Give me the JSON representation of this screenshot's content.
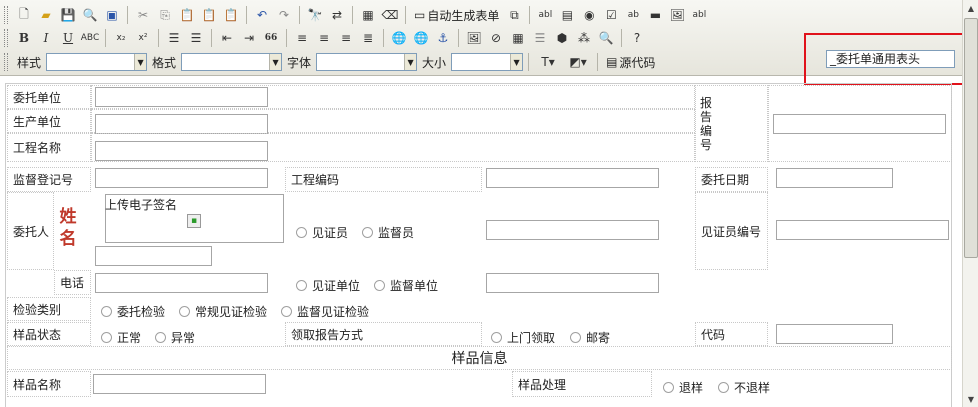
{
  "toolbar": {
    "auto_form": "自动生成表单",
    "style_label": "样式",
    "format_label": "格式",
    "font_label": "字体",
    "size_label": "大小",
    "source_label": "源代码",
    "header_field_value": "_委托单通用表头",
    "icons_row1": [
      "new-doc-icon",
      "open-folder-icon",
      "save-icon",
      "preview-icon",
      "template-icon",
      "cut-icon",
      "copy-icon",
      "paste-icon",
      "paste-text-icon",
      "paste-word-icon",
      "undo-icon",
      "redo-icon",
      "find-icon",
      "replace-icon",
      "select-all-icon",
      "eraser-icon",
      "form-icon",
      "form-attr-icon",
      "textfield-icon",
      "textarea-icon",
      "radio-icon",
      "checkbox-icon",
      "list-icon",
      "button-icon",
      "image-button-icon",
      "hidden-field-icon"
    ],
    "icons_row2": [
      "bold-icon",
      "italic-icon",
      "underline-icon",
      "strikethrough-icon",
      "subscript-icon",
      "superscript-icon",
      "ordered-list-icon",
      "unordered-list-icon",
      "outdent-icon",
      "indent-icon",
      "blockquote-icon",
      "align-left-icon",
      "align-center-icon",
      "align-right-icon",
      "justify-icon",
      "link-icon",
      "unlink-icon",
      "anchor-icon",
      "image-icon",
      "flash-icon",
      "table-icon",
      "hr-icon",
      "smiley-icon",
      "special-char-icon",
      "pagebreak-icon",
      "about-icon"
    ],
    "bold": "B",
    "italic": "I",
    "underline": "U",
    "strike": "ABC",
    "sub": "x₂",
    "sup": "x²",
    "quote": "66",
    "help": "?"
  },
  "form": {
    "entrust_unit": "委托单位",
    "production_unit": "生产单位",
    "project_name": "工程名称",
    "report_no": "报告编号",
    "supervision_reg_no": "监督登记号",
    "project_code": "工程编码",
    "entrust_date": "委托日期",
    "client": "委托人",
    "name_char1": "姓",
    "name_char2": "名",
    "upload_signature": "上传电子签名",
    "witness": "见证员",
    "supervisor": "监督员",
    "witness_no": "见证员编号",
    "phone": "电话",
    "witness_unit": "见证单位",
    "supervision_unit": "监督单位",
    "inspection_type": "检验类别",
    "entrusted_inspection": "委托检验",
    "regular_witness_inspection": "常规见证检验",
    "supervision_witness_inspection": "监督见证检验",
    "sample_status": "样品状态",
    "normal": "正常",
    "abnormal": "异常",
    "report_pickup": "领取报告方式",
    "onsite_pickup": "上门领取",
    "mail": "邮寄",
    "code": "代码",
    "sample_info": "样品信息",
    "sample_name": "样品名称",
    "sample_handling": "样品处理",
    "return_sample": "退样",
    "no_return": "不退样"
  }
}
